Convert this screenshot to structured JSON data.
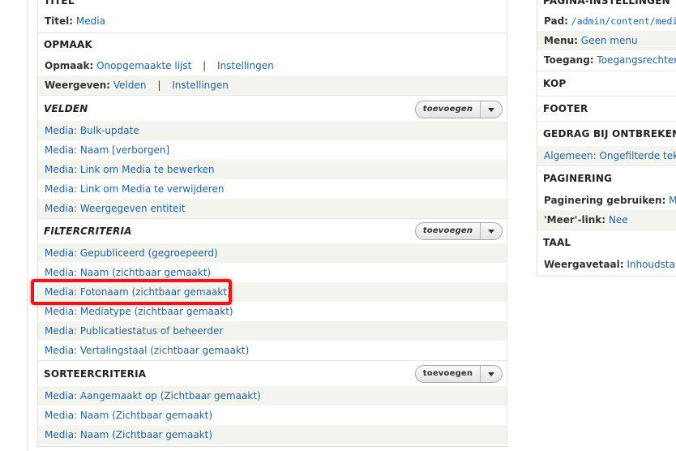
{
  "left": {
    "titel": {
      "header": "TITEL",
      "label": "Titel:",
      "value": "Media"
    },
    "opmaak": {
      "header": "OPMAAK",
      "opmaak_label": "Opmaak:",
      "opmaak_value": "Onopgemaakte lijst",
      "separator": "|",
      "instellingen": "Instellingen",
      "weergeven_label": "Weergeven:",
      "weergeven_value": "Velden"
    },
    "velden": {
      "header": "VELDEN",
      "add_label": "toevoegen",
      "items": [
        "Media: Bulk-update",
        "Media: Naam [verborgen]",
        "Media: Link om Media te bewerken",
        "Media: Link om Media te verwijderen",
        "Media: Weergegeven entiteit"
      ]
    },
    "filtercriteria": {
      "header": "FILTERCRITERIA",
      "add_label": "toevoegen",
      "items": [
        "Media: Gepubliceerd (gegroepeerd)",
        "Media: Naam (zichtbaar gemaakt)",
        "Media: Fotonaam (zichtbaar gemaakt)",
        "Media: Mediatype (zichtbaar gemaakt)",
        "Media: Publicatiestatus of beheerder",
        "Media: Vertalingstaal (zichtbaar gemaakt)"
      ]
    },
    "sorteercriteria": {
      "header": "SORTEERCRITERIA",
      "add_label": "toevoegen",
      "items": [
        "Media: Aangemaakt op (Zichtbaar gemaakt)",
        "Media: Naam (Zichtbaar gemaakt)",
        "Media: Naam (Zichtbaar gemaakt)"
      ]
    }
  },
  "right": {
    "pagina": {
      "header": "PAGINA-INSTELLINGEN",
      "pad_label": "Pad:",
      "pad_value": "/admin/content/medi",
      "menu_label": "Menu:",
      "menu_value": "Geen menu",
      "toegang_label": "Toegang:",
      "toegang_value": "Toegangsrechten"
    },
    "kop": {
      "header": "KOP"
    },
    "footer": {
      "header": "FOOTER"
    },
    "gedrag": {
      "header": "GEDRAG BIJ ONTBREKEN V",
      "algemeen": "Algemeen: Ongefilterde teks"
    },
    "paginering": {
      "header": "PAGINERING",
      "gebruiken_label": "Paginering gebruiken:",
      "gebruiken_value": "Min",
      "meer_label": "'Meer'-link:",
      "meer_value": "Nee"
    },
    "taal": {
      "header": "TAAL",
      "weergavetaal_label": "Weergavetaal:",
      "weergavetaal_value": "Inhoudstaal"
    }
  },
  "colors": {
    "link": "#1e64a9",
    "stripe": "#f3f4ee",
    "highlight": "#e8151b"
  }
}
